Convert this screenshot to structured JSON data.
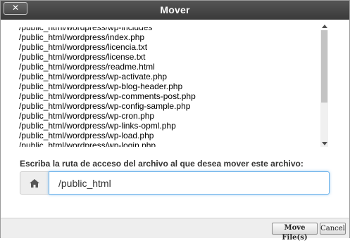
{
  "dialog": {
    "title": "Mover",
    "close_icon": "close-icon",
    "close_label": "✕"
  },
  "file_list": {
    "items": [
      "/public_html/wordpress/wp-includes",
      "/public_html/wordpress/index.php",
      "/public_html/wordpress/licencia.txt",
      "/public_html/wordpress/license.txt",
      "/public_html/wordpress/readme.html",
      "/public_html/wordpress/wp-activate.php",
      "/public_html/wordpress/wp-blog-header.php",
      "/public_html/wordpress/wp-comments-post.php",
      "/public_html/wordpress/wp-config-sample.php",
      "/public_html/wordpress/wp-cron.php",
      "/public_html/wordpress/wp-links-opml.php",
      "/public_html/wordpress/wp-load.php",
      "/public_html/wordpress/wp-login.php"
    ]
  },
  "destination": {
    "label": "Escriba la ruta de acceso del archivo al que desea mover este archivo:",
    "home_icon": "home-icon",
    "path_value": "/public_html"
  },
  "footer": {
    "move_label": "Move File(s)",
    "cancel_label": "Cancel"
  }
}
